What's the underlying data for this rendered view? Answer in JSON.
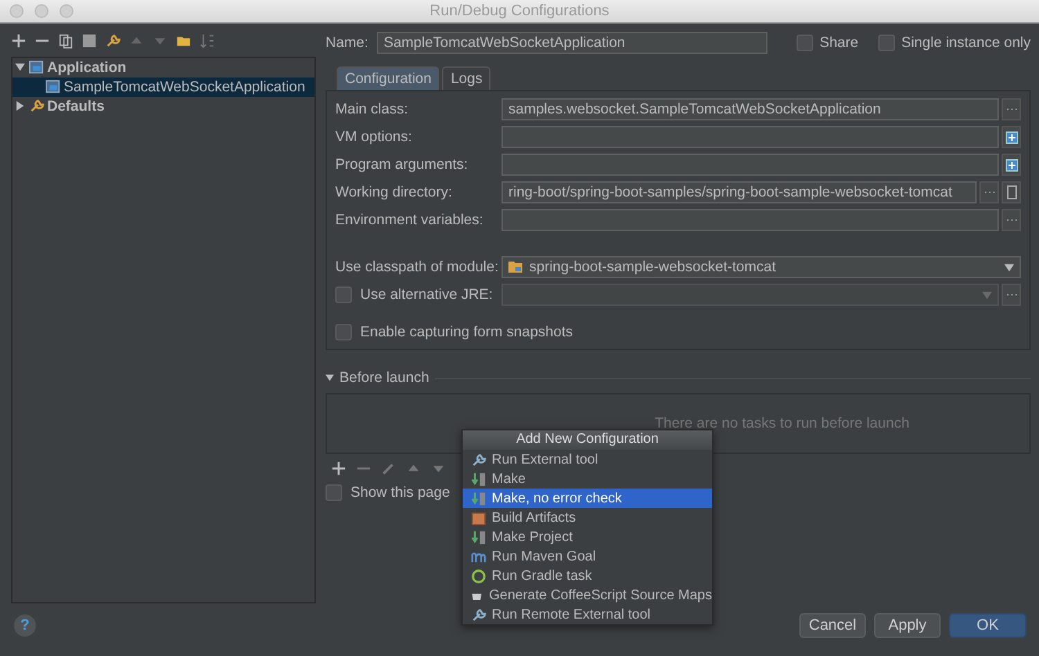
{
  "window": {
    "title": "Run/Debug Configurations"
  },
  "tree": [
    {
      "label": "Application",
      "kind": "application",
      "expanded": true,
      "selected": false,
      "children": [
        {
          "label": "SampleTomcatWebSocketApplication",
          "kind": "application",
          "selected": true
        }
      ]
    },
    {
      "label": "Defaults",
      "kind": "defaults",
      "expanded": false,
      "selected": false
    }
  ],
  "name_field": {
    "label": "Name:",
    "value": "SampleTomcatWebSocketApplication"
  },
  "options": [
    {
      "label": "Share",
      "checked": false
    },
    {
      "label": "Single instance only",
      "checked": false
    }
  ],
  "tabs": [
    {
      "label": "Configuration",
      "selected": true
    },
    {
      "label": "Logs",
      "selected": false
    }
  ],
  "form": [
    {
      "kind": "field",
      "label": "Main class:",
      "value": "samples.websocket.SampleTomcatWebSocketApplication",
      "buttons": [
        {
          "kind": "browse"
        }
      ]
    },
    {
      "kind": "field",
      "label": "VM options:",
      "buttons": [
        {
          "kind": "expand"
        }
      ]
    },
    {
      "kind": "field",
      "label": "Program arguments:",
      "buttons": [
        {
          "kind": "expand"
        }
      ]
    },
    {
      "kind": "field",
      "label": "Working directory:",
      "value": "ring-boot/spring-boot-samples/spring-boot-sample-websocket-tomcat",
      "buttons": [
        {
          "kind": "browse"
        },
        {
          "kind": "macro"
        }
      ]
    },
    {
      "kind": "field",
      "label": "Environment variables:",
      "buttons": [
        {
          "kind": "browse"
        }
      ]
    },
    {
      "kind": "select",
      "label": "Use classpath of module:",
      "value": "spring-boot-sample-websocket-tomcat"
    },
    {
      "kind": "checkbox-select",
      "label": "Use alternative JRE:",
      "checked": false,
      "buttons": [
        {
          "kind": "browse"
        }
      ]
    },
    {
      "kind": "checkbox",
      "label": "Enable capturing form snapshots",
      "checked": false
    }
  ],
  "before_launch": {
    "title": "Before launch",
    "expanded": true,
    "empty_text": "There are no tasks to run before launch"
  },
  "show_page": {
    "label": "Show this page",
    "checked": false
  },
  "popup": {
    "title": "Add New Configuration",
    "items": [
      {
        "label": "Run External tool",
        "kind": "tool",
        "selected": false
      },
      {
        "label": "Make",
        "kind": "make",
        "selected": false
      },
      {
        "label": "Make, no error check",
        "kind": "make",
        "selected": true
      },
      {
        "label": "Build Artifacts",
        "kind": "artifacts",
        "selected": false
      },
      {
        "label": "Make Project",
        "kind": "make",
        "selected": false
      },
      {
        "label": "Run Maven Goal",
        "kind": "maven",
        "selected": false
      },
      {
        "label": "Run Gradle task",
        "kind": "gradle",
        "selected": false
      },
      {
        "label": "Generate CoffeeScript Source Maps",
        "kind": "coffee",
        "selected": false
      },
      {
        "label": "Run Remote External tool",
        "kind": "tool",
        "selected": false
      }
    ]
  },
  "help": "?",
  "buttons": [
    {
      "label": "Cancel",
      "kind": "default"
    },
    {
      "label": "Apply",
      "kind": "default"
    },
    {
      "label": "OK",
      "kind": "primary"
    }
  ]
}
